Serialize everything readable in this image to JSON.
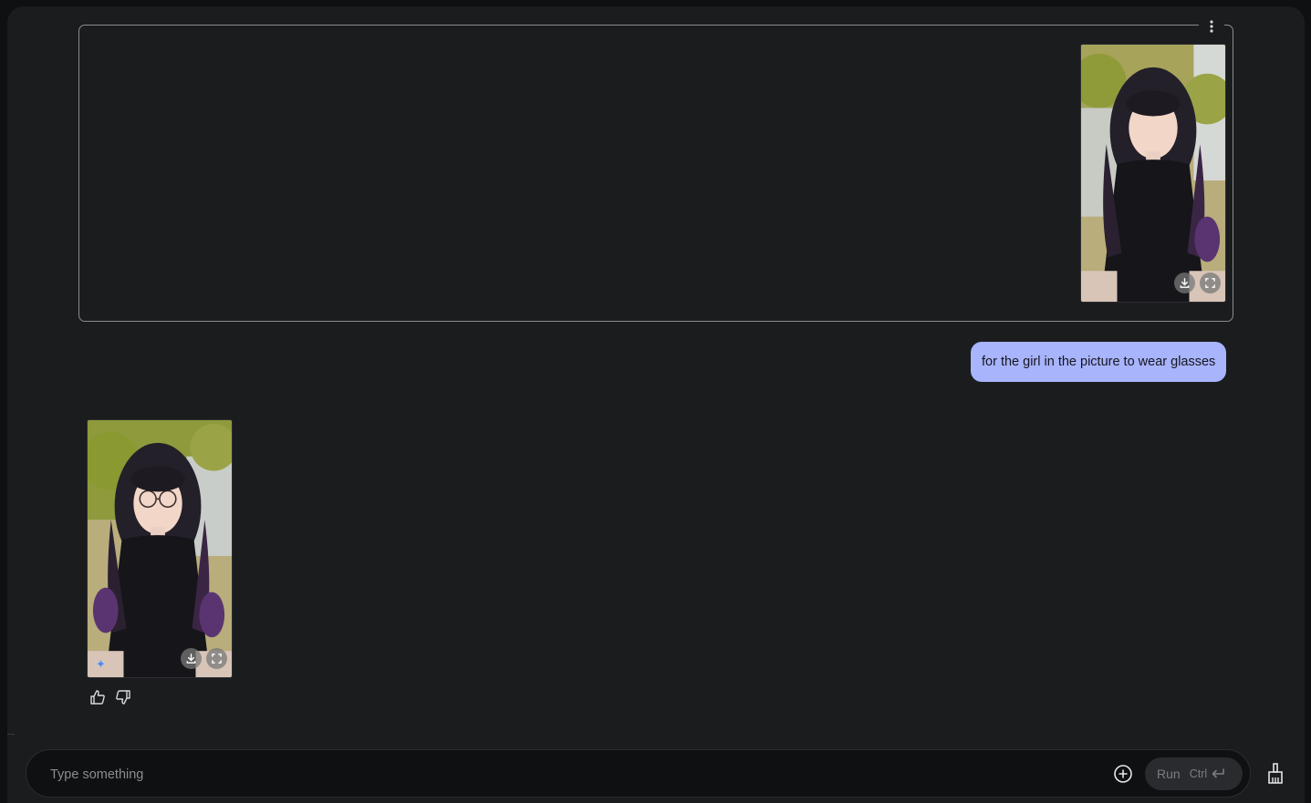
{
  "user_turn": {
    "image_icon": "portrait-photo",
    "download_icon": "download-icon",
    "expand_icon": "fullscreen-icon",
    "more_icon": "more-vert-icon",
    "prompt_text": "for the girl in the picture to wear glasses"
  },
  "model_turn": {
    "image_icon": "portrait-photo-with-glasses",
    "badge_icon": "sparkle-icon",
    "badge_glyph": "✦",
    "feedback": {
      "thumbs_up_icon": "thumbs-up-icon",
      "thumbs_down_icon": "thumbs-down-icon"
    }
  },
  "composer": {
    "placeholder": "Type something",
    "value": "",
    "add_icon": "add-circle-icon",
    "run_label": "Run",
    "shortcut_label": "Ctrl",
    "shortcut_icon": "enter-icon",
    "clear_icon": "broom-icon"
  },
  "colors": {
    "app_bg": "#1b1c1e",
    "bubble_bg": "#a8b4fb",
    "composer_bg": "#0f1012",
    "accent_sparkle": "#4d8df7"
  }
}
